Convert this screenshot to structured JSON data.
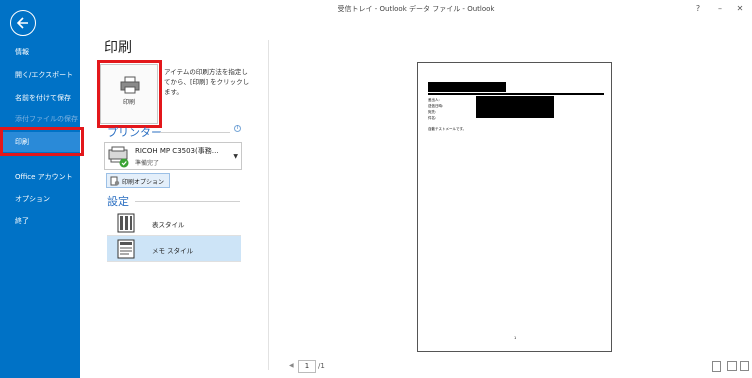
{
  "window": {
    "title": "受信トレイ - Outlook データ ファイル - Outlook",
    "help": "?",
    "minimize": "–",
    "close": "✕"
  },
  "sidebar": {
    "items": [
      {
        "label": "情報"
      },
      {
        "label": "開く/エクスポート"
      },
      {
        "label": "名前を付けて保存"
      },
      {
        "label": "添付ファイルの保存"
      },
      {
        "label": "印刷"
      },
      {
        "label": "Office アカウント"
      },
      {
        "label": "オプション"
      },
      {
        "label": "終了"
      }
    ],
    "selected": "印刷"
  },
  "main": {
    "title": "印刷",
    "print_button": "印刷",
    "print_description": "アイテムの印刷方法を指定してから、[印刷] をクリックします。",
    "printer_section": "プリンター",
    "info": "i",
    "printer": {
      "name": "RICOH MP C3503(事務…",
      "status": "準備完了"
    },
    "print_options": "印刷オプション",
    "settings_section": "設定",
    "styles": [
      {
        "label": "表スタイル"
      },
      {
        "label": "メモ スタイル"
      }
    ],
    "selected_style": "メモ スタイル"
  },
  "preview": {
    "fields": [
      "差出人:",
      "送信日時:",
      "宛先:",
      "件名:"
    ],
    "body": "自動テストメールです。",
    "footer_page": "1",
    "pager": {
      "prev": "◀",
      "current": "1",
      "total": "/1"
    }
  },
  "colors": {
    "accent": "#0072c6",
    "highlight": "#e3171b",
    "section": "#2b6fc2"
  }
}
